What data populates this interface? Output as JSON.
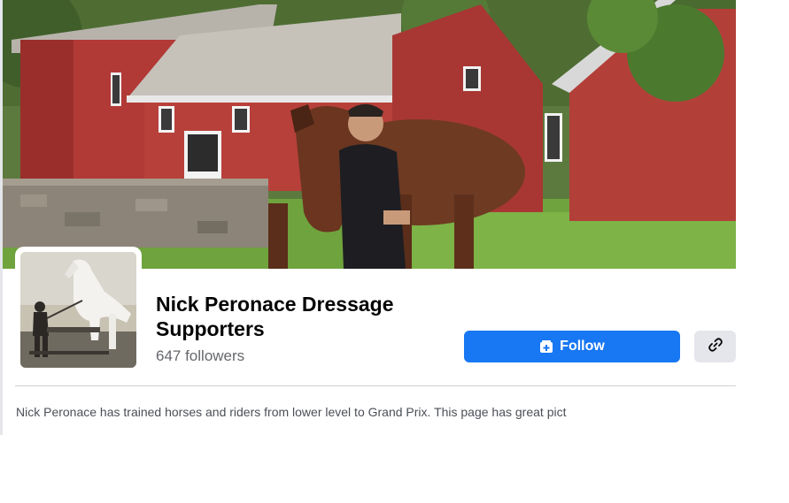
{
  "page": {
    "name": "Nick Peronace Dressage Supporters",
    "followers": "647 followers",
    "about": "Nick Peronace has trained horses and riders from lower level to Grand Prix. This page has great pict"
  },
  "actions": {
    "follow_label": "Follow",
    "follow_icon": "follow-page-icon",
    "link_icon": "link-icon"
  },
  "colors": {
    "primary": "#1877f2",
    "secondary_button": "#e4e6eb",
    "text_primary": "#050505",
    "text_secondary": "#65676b"
  }
}
